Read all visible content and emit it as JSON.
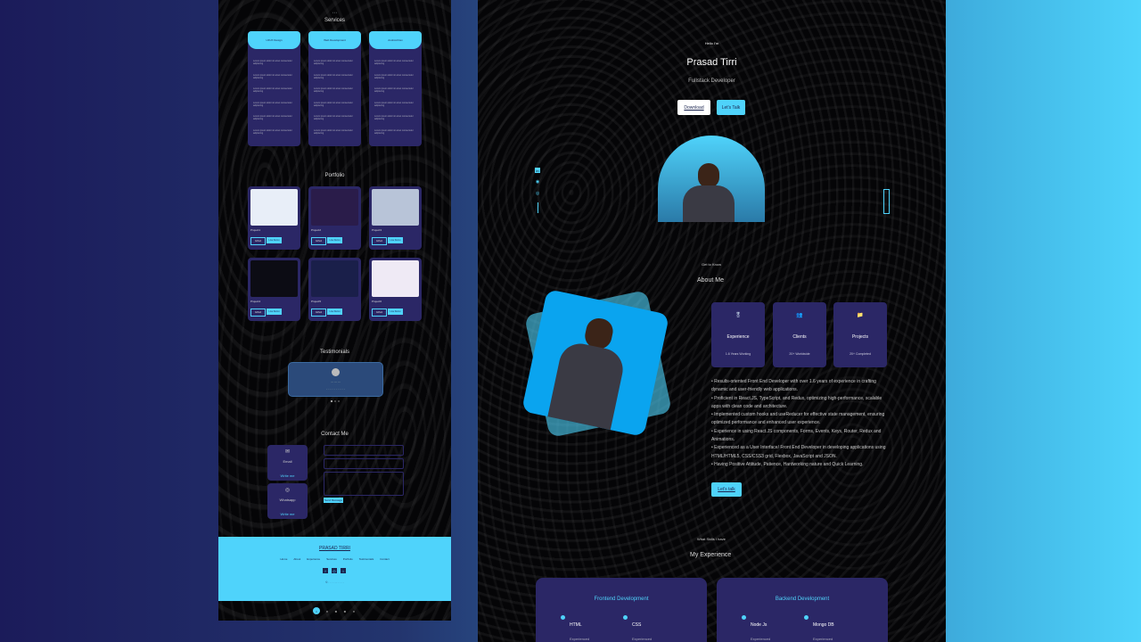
{
  "left": {
    "services": {
      "title": "Services",
      "cols": [
        {
          "header": "UI/UX Design"
        },
        {
          "header": "Web Development"
        },
        {
          "header": "Android Dev"
        }
      ],
      "item_text": "Lorem ipsum dolor sit amet consectetur adipiscing"
    },
    "portfolio": {
      "title": "Portfolio",
      "projects": [
        {
          "name": "Project1",
          "btn1": "Github",
          "btn2": "Live Demo"
        },
        {
          "name": "Project2",
          "btn1": "Github",
          "btn2": "Live Demo"
        },
        {
          "name": "Project3",
          "btn1": "Github",
          "btn2": "Live Demo"
        },
        {
          "name": "Project4",
          "btn1": "Github",
          "btn2": "Live Demo"
        },
        {
          "name": "Project5",
          "btn1": "Github",
          "btn2": "Live Demo"
        },
        {
          "name": "Project6",
          "btn1": "Github",
          "btn2": "Live Demo"
        }
      ]
    },
    "testimonials": {
      "title": "Testimonials"
    },
    "contact": {
      "title": "Contact Me",
      "cards": [
        {
          "label": "Email",
          "link": "Write me"
        },
        {
          "label": "Whatsapp",
          "link": "Write me"
        }
      ],
      "send": "Send Message"
    },
    "footer": {
      "name": "PRASAD TIRRI",
      "links": [
        "Home",
        "About",
        "Experience",
        "Services",
        "Portfolio",
        "Testimonials",
        "Contact"
      ]
    }
  },
  "right": {
    "hero": {
      "greeting": "Hello I'm",
      "name": "Prasad Tirri",
      "role": "Fullstack Developer",
      "download": "Download",
      "talk": "Let's Talk"
    },
    "about": {
      "kicker": "Get to Know",
      "title": "About Me",
      "cards": [
        {
          "title": "Experience",
          "sub": "1.6 Years Working"
        },
        {
          "title": "Clients",
          "sub": "20+ Worldwide"
        },
        {
          "title": "Projects",
          "sub": "20+ Completed"
        }
      ],
      "bullets": [
        "• Results-oriented Front End Developer with over 1.6 years of experience in crafting dynamic and user-friendly web applications.",
        "• Proficient in React.JS, TypeScript, and Redux, optimizing high-performance, scalable apps with clean code and architecture.",
        "• Implemented custom hooks and useReducer for effective state management, ensuring optimized performance and enhanced user experience.",
        "• Experience in using React.JS components, Forms, Events, Keys, Router, Redux and Animations.",
        "• Experienced as a User Interface/ Front End Developer in developing applications using HTML/HTML5, CSS/CSS3 grid, Flexbox, JavaScript and JSON.",
        "• Having Positive Attitude, Patience, Hardworking nature and Quick Learning."
      ],
      "cta": "Let's talk"
    },
    "experience": {
      "kicker": "What Skills I have",
      "title": "My Experience",
      "cards": [
        {
          "title": "Frontend Development",
          "skills": [
            {
              "name": "HTML",
              "level": "Experienced"
            },
            {
              "name": "CSS",
              "level": "Experienced"
            }
          ]
        },
        {
          "title": "Backend Development",
          "skills": [
            {
              "name": "Node Js",
              "level": "Experienced"
            },
            {
              "name": "Mongo DB",
              "level": "Experienced"
            }
          ]
        }
      ]
    }
  },
  "colors": {
    "accent": "#4fd3fb",
    "card": "#2b2766",
    "bg": "#050507"
  }
}
